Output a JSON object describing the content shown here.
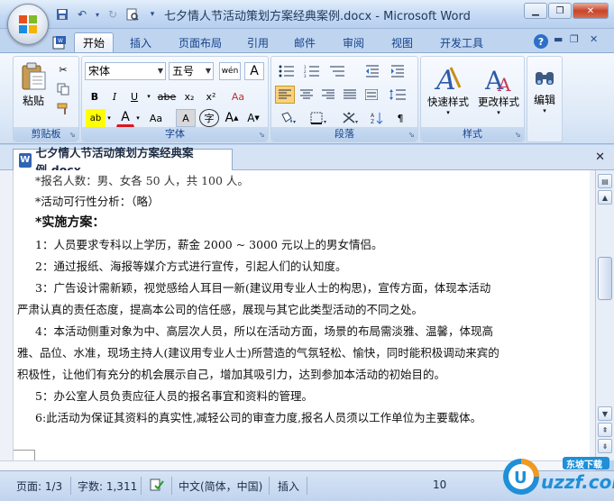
{
  "window": {
    "title": "七夕情人节活动策划方案经典案例.docx - Microsoft Word"
  },
  "tabs": [
    "开始",
    "插入",
    "页面布局",
    "引用",
    "邮件",
    "审阅",
    "视图",
    "开发工具"
  ],
  "ribbon": {
    "clipboard": {
      "label": "剪贴板",
      "paste": "粘贴"
    },
    "font": {
      "label": "字体",
      "font_name": "宋体",
      "font_size": "五号",
      "wen": "wén",
      "big_a": "A",
      "bold": "B",
      "italic": "I",
      "underline": "U",
      "strike": "abe",
      "sub": "x₂",
      "sup": "x²",
      "clear": "Aa",
      "char_shade": "A",
      "enclose": "字",
      "grow": "A",
      "shrink": "A",
      "highlight": "ab",
      "fontcolor": "A",
      "case": "Aa"
    },
    "paragraph": {
      "label": "段落"
    },
    "styles": {
      "label": "样式",
      "quick": "快速样式",
      "change": "更改样式"
    },
    "editing": {
      "label": "编辑"
    }
  },
  "doc_tab": "七夕情人节活动策划方案经典案例.docx",
  "document": {
    "lines": [
      {
        "text": "*报名人数：男、女各 50 人，共 100 人。",
        "type": "normal"
      },
      {
        "text": "*活动可行性分析：（略）",
        "type": "normal"
      },
      {
        "text": "*实施方案：",
        "type": "heading"
      },
      {
        "text": "1：人员要求专科以上学历，薪金 2000 ~ 3000 元以上的男女情侣。",
        "type": "normal"
      },
      {
        "text": "2：通过报纸、海报等媒介方式进行宣传，引起人们的认知度。",
        "type": "normal"
      },
      {
        "text": "3：广告设计需新颖，视觉感给人耳目一新(建议用专业人士的构思)，宣传方面，体现本活动",
        "type": "normal"
      },
      {
        "text": "严肃认真的责任态度，提高本公司的信任感，展现与其它此类型活动的不同之处。",
        "type": "cont"
      },
      {
        "text": "4：本活动侧重对象为中、高层次人员，所以在活动方面，场景的布局需淡雅、温馨，体现高",
        "type": "normal"
      },
      {
        "text": "雅、品位、水准，现场主持人(建议用专业人士)所营造的气氛轻松、愉快，同时能积极调动来宾的",
        "type": "cont"
      },
      {
        "text": "积极性，让他们有充分的机会展示自己，增加其吸引力，达到参加本活动的初始目的。",
        "type": "cont"
      },
      {
        "text": "5：办公室人员负责应征人员的报名事宜和资料的管理。",
        "type": "normal"
      },
      {
        "text": "6:此活动为保证其资料的真实性,减轻公司的审查力度,报名人员须以工作单位为主要载体。",
        "type": "normal"
      }
    ]
  },
  "status": {
    "page": "页面: 1/3",
    "words": "字数: 1,311",
    "language": "中文(简体，中国)",
    "mode": "插入",
    "zoom": "10"
  },
  "watermark": {
    "brand": "uzzf.com",
    "tag": "东坡下载"
  },
  "colors": {
    "accent": "#15428b",
    "ribbon_bg": "#dde9f7",
    "status_bg": "#c9daf0"
  }
}
